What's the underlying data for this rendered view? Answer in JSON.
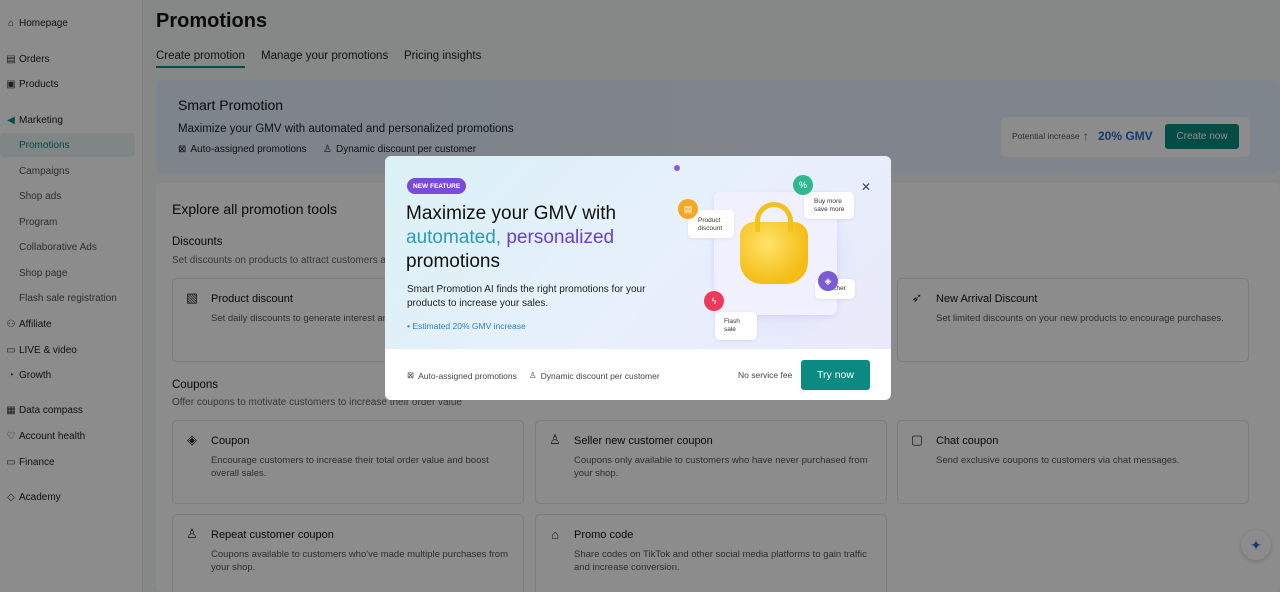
{
  "sidebar": {
    "items": [
      {
        "label": "Homepage",
        "icon": "home-icon"
      },
      {
        "label": "Orders",
        "icon": "orders-icon"
      },
      {
        "label": "Products",
        "icon": "products-icon"
      },
      {
        "label": "Marketing",
        "icon": "megaphone-icon"
      },
      {
        "label": "Promotions"
      },
      {
        "label": "Campaigns"
      },
      {
        "label": "Shop ads"
      },
      {
        "label": "Program"
      },
      {
        "label": "Collaborative Ads"
      },
      {
        "label": "Shop page"
      },
      {
        "label": "Flash sale registration"
      },
      {
        "label": "Affiliate",
        "icon": "affiliate-icon"
      },
      {
        "label": "LIVE & video",
        "icon": "live-icon"
      },
      {
        "label": "Growth",
        "icon": "growth-icon"
      },
      {
        "label": "Data compass",
        "icon": "chart-icon"
      },
      {
        "label": "Account health",
        "icon": "health-icon"
      },
      {
        "label": "Finance",
        "icon": "finance-icon"
      },
      {
        "label": "Academy",
        "icon": "academy-icon"
      }
    ]
  },
  "header": {
    "title": "Promotions",
    "tabs": [
      "Create promotion",
      "Manage your promotions",
      "Pricing insights"
    ]
  },
  "smart": {
    "title": "Smart Promotion",
    "subtitle": "Maximize your GMV with automated and personalized promotions",
    "feature1": "Auto-assigned promotions",
    "feature2": "Dynamic discount per customer",
    "potential_label": "Potential increase",
    "potential_value": "20% GMV",
    "create_label": "Create now"
  },
  "explore": {
    "title": "Explore all promotion tools",
    "discounts_title": "Discounts",
    "discounts_sub": "Set discounts on products to attract customers and boost sales.",
    "coupons_title": "Coupons",
    "coupons_sub": "Offer coupons to motivate customers to increase their order value",
    "discount_cards": [
      {
        "title": "Product discount",
        "desc": "Set daily discounts to generate interest and boost sales."
      },
      {
        "title": "New Arrival Discount",
        "desc": "Set limited discounts on your new products to encourage purchases."
      }
    ],
    "coupon_cards": [
      {
        "title": "Coupon",
        "desc": "Encourage customers to increase their total order value and boost overall sales."
      },
      {
        "title": "Seller new customer coupon",
        "desc": "Coupons only available to customers who have never purchased from your shop."
      },
      {
        "title": "Chat coupon",
        "desc": "Send exclusive coupons to customers via chat messages."
      },
      {
        "title": "Repeat customer coupon",
        "desc": "Coupons available to customers who've made multiple purchases from your shop."
      },
      {
        "title": "Promo code",
        "desc": "Share codes on TikTok and other social media platforms to gain traffic and increase conversion."
      }
    ]
  },
  "modal": {
    "badge": "NEW FEATURE",
    "headline1": "Maximize your GMV with",
    "headline_accent1": "automated,",
    "headline_accent2": "personalized",
    "headline3": "promotions",
    "description": "Smart Promotion AI finds the right promotions for your products to increase your sales.",
    "estimate": "Estimated 20% GMV increase",
    "bubbles": {
      "product_discount": "Product discount",
      "buy_more": "Buy more save more",
      "voucher": "Voucher",
      "flash_sale": "Flash sale"
    },
    "footer_feature1": "Auto-assigned promotions",
    "footer_feature2": "Dynamic discount per customer",
    "fee": "No service fee",
    "try_label": "Try now"
  },
  "colors": {
    "accent": "#0a8a80",
    "purple": "#7b4bd6",
    "blue": "#2a6bd0"
  }
}
